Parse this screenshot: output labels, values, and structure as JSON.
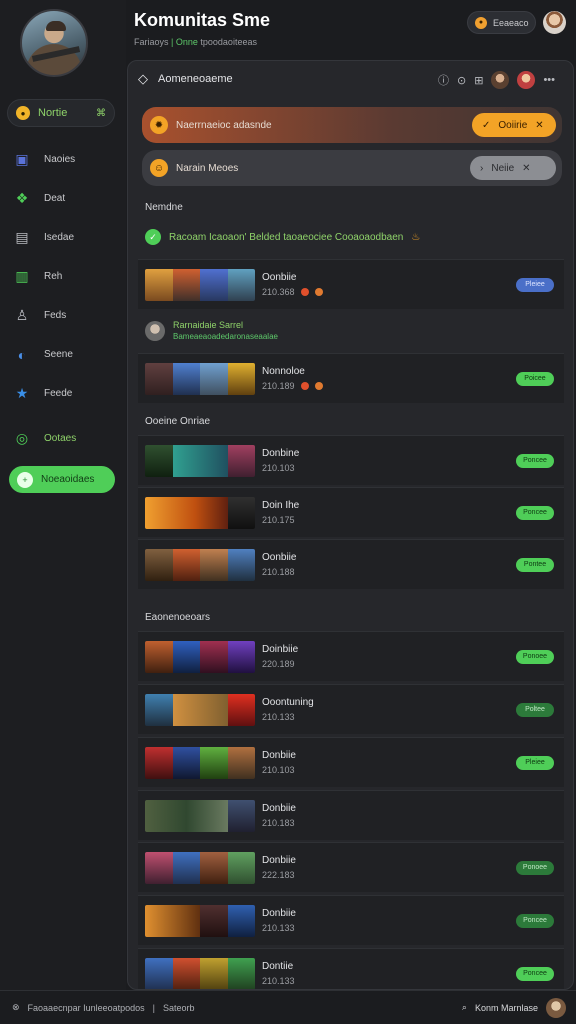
{
  "header": {
    "title": "Komunitas Sme",
    "subtitle_prefix": "Fariaoys",
    "subtitle_highlight": "| Onne",
    "subtitle_suffix": "tpoodaoiteeas",
    "button_label": "Eeaeaco"
  },
  "sidebar": {
    "status_label": "Nortie",
    "status_caret": "⌘",
    "items": [
      {
        "label": "Naoies",
        "icon": "chat-icon",
        "color": "#5a72d8"
      },
      {
        "label": "Deat",
        "icon": "group-icon",
        "color": "#4fce58"
      },
      {
        "label": "Isedae",
        "icon": "doc-icon",
        "color": "#b8bac0"
      },
      {
        "label": "Reh",
        "icon": "chart-icon",
        "color": "#4fce58"
      },
      {
        "label": "Feds",
        "icon": "person-icon",
        "color": "#b8bac0"
      },
      {
        "label": "Seene",
        "icon": "compass-icon",
        "color": "#4a8fe8"
      },
      {
        "label": "Feede",
        "icon": "star-icon",
        "color": "#3a8fe8"
      },
      {
        "label": "Ootaes",
        "icon": "circle-icon",
        "color": "#4fce58"
      }
    ],
    "cta_label": "Noeaoidaes"
  },
  "panel": {
    "title": "Aomeneoaeme",
    "banner1": {
      "text": "Naerrnaeioc adasnde",
      "button": "Ooiirie"
    },
    "banner2": {
      "text": "Narain Meoes",
      "button": "Neiie"
    },
    "section1": "Nemdne",
    "promo": "Racoam Icaoaon' Belded taoaeociee Cooaoaodbaen",
    "section2": "Ooeine Onriae",
    "section3": "Eaonenoeoars",
    "friend": {
      "name": "Rarnaidaie Sarrel",
      "sub": "Bameaeaoadedaronaseaalae"
    }
  },
  "rows": [
    {
      "t1": "Oonbiie",
      "t2": "210.368",
      "badge": "Pleiee",
      "style": "blue",
      "dots": true
    },
    {
      "t1": "Nonnoloe",
      "t2": "210.189",
      "badge": "Poicee",
      "style": "green",
      "dots": true
    },
    {
      "t1": "Donbine",
      "t2": "210.103",
      "badge": "Poncee",
      "style": "green",
      "dots": false
    },
    {
      "t1": "Doin Ihe",
      "t2": "210.175",
      "badge": "Poncee",
      "style": "green",
      "dots": false
    },
    {
      "t1": "Oonbiie",
      "t2": "210.188",
      "badge": "Pontee",
      "style": "green",
      "dots": false
    },
    {
      "t1": "Doinbiie",
      "t2": "220.189",
      "badge": "Ponoee",
      "style": "green",
      "dots": false
    },
    {
      "t1": "Ooontuning",
      "t2": "210.133",
      "badge": "Poltee",
      "style": "dim",
      "dots": false
    },
    {
      "t1": "Donbiie",
      "t2": "210.103",
      "badge": "Pleiee",
      "style": "green",
      "dots": false
    },
    {
      "t1": "Donbiie",
      "t2": "210.183",
      "badge": "",
      "style": "none",
      "dots": false
    },
    {
      "t1": "Donbiie",
      "t2": "222.183",
      "badge": "Ponoee",
      "style": "dim",
      "dots": false
    },
    {
      "t1": "Donbiie",
      "t2": "210.133",
      "badge": "Poncee",
      "style": "dim",
      "dots": false
    },
    {
      "t1": "Dontiie",
      "t2": "210.133",
      "badge": "Poncee",
      "style": "green",
      "dots": false
    }
  ],
  "footer": {
    "left_text": "Faoaaecnpar Iunleeoatpodos",
    "left_text2": "Sateorb",
    "right_text": "Konm Marnlase"
  }
}
